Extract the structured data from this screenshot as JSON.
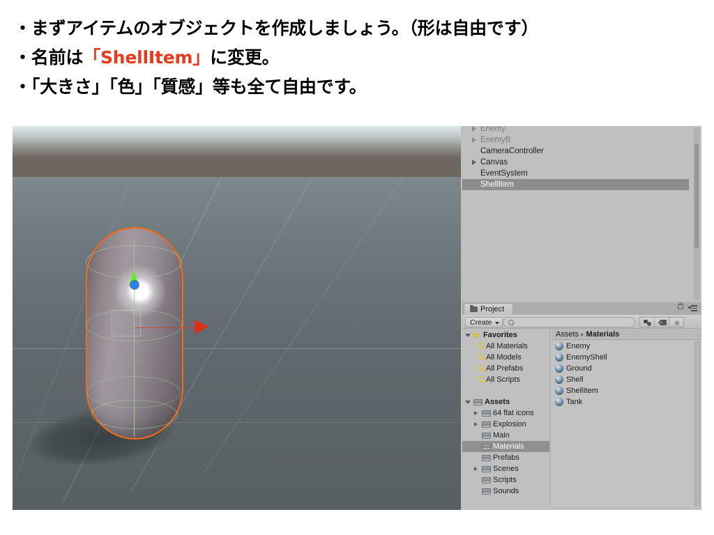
{
  "slide": {
    "bullets": [
      "・まずアイテムのオブジェクトを作成しましょう。（形は自由です）",
      "・名前は",
      "「ShellItem」",
      "に変更。",
      "・「大きさ」「色」「質感」等も全て自由です。"
    ],
    "accent_color": "#e8391a"
  },
  "hierarchy": {
    "items": [
      {
        "label": "Enemy",
        "expandable": true,
        "dim": true,
        "selected": false
      },
      {
        "label": "EnemyB",
        "expandable": true,
        "dim": true,
        "selected": false
      },
      {
        "label": "CameraController",
        "expandable": false,
        "dim": false,
        "selected": false
      },
      {
        "label": "Canvas",
        "expandable": true,
        "dim": false,
        "selected": false
      },
      {
        "label": "EventSystem",
        "expandable": false,
        "dim": false,
        "selected": false
      },
      {
        "label": "ShellItem",
        "expandable": false,
        "dim": false,
        "selected": true
      }
    ]
  },
  "project": {
    "tab_label": "Project",
    "tab_icon": "folder-icon",
    "lock_icon": "lock-icon",
    "menu_icon": "options-menu-icon",
    "create_label": "Create",
    "search_value": "",
    "search_placeholder": "",
    "filter_buttons": [
      {
        "name": "filter-by-type",
        "icon": "shapes-icon"
      },
      {
        "name": "filter-by-label",
        "icon": "tag-icon"
      },
      {
        "name": "filter-favorites",
        "icon": "star-icon",
        "glyph": "★"
      }
    ],
    "breadcrumb": {
      "root": "Assets",
      "separator": "▸",
      "current": "Materials"
    },
    "tree": [
      {
        "label": "Favorites",
        "kind": "favorites",
        "bold": true,
        "expanded": true,
        "depth": 0,
        "selected": false
      },
      {
        "label": "All Materials",
        "kind": "search",
        "bold": false,
        "depth": 1,
        "selected": false
      },
      {
        "label": "All Models",
        "kind": "search",
        "bold": false,
        "depth": 1,
        "selected": false
      },
      {
        "label": "All Prefabs",
        "kind": "search",
        "bold": false,
        "depth": 1,
        "selected": false
      },
      {
        "label": "All Scripts",
        "kind": "search",
        "bold": false,
        "depth": 1,
        "selected": false
      },
      {
        "label": "",
        "kind": "spacer",
        "bold": false,
        "depth": 0,
        "selected": false
      },
      {
        "label": "Assets",
        "kind": "folder",
        "bold": true,
        "expanded": true,
        "depth": 0,
        "selected": false
      },
      {
        "label": "64 flat icons",
        "kind": "folder",
        "bold": false,
        "expandable": true,
        "depth": 1,
        "selected": false
      },
      {
        "label": "Explosion",
        "kind": "folder",
        "bold": false,
        "expandable": true,
        "depth": 1,
        "selected": false
      },
      {
        "label": "Main",
        "kind": "folder",
        "bold": false,
        "expandable": false,
        "depth": 1,
        "selected": false
      },
      {
        "label": "Materials",
        "kind": "folder",
        "bold": false,
        "expandable": false,
        "depth": 1,
        "selected": true
      },
      {
        "label": "Prefabs",
        "kind": "folder",
        "bold": false,
        "expandable": false,
        "depth": 1,
        "selected": false
      },
      {
        "label": "Scenes",
        "kind": "folder",
        "bold": false,
        "expandable": true,
        "depth": 1,
        "selected": false
      },
      {
        "label": "Scripts",
        "kind": "folder",
        "bold": false,
        "expandable": false,
        "depth": 1,
        "selected": false
      },
      {
        "label": "Sounds",
        "kind": "folder",
        "bold": false,
        "expandable": false,
        "depth": 1,
        "selected": false
      }
    ],
    "assets": [
      {
        "label": "Enemy",
        "icon": "material-sphere-icon"
      },
      {
        "label": "EnemyShell",
        "icon": "material-sphere-icon"
      },
      {
        "label": "Ground",
        "icon": "material-sphere-icon"
      },
      {
        "label": "Shell",
        "icon": "material-sphere-icon"
      },
      {
        "label": "ShellItem",
        "icon": "material-sphere-icon"
      },
      {
        "label": "Tank",
        "icon": "material-sphere-icon"
      }
    ]
  },
  "scene": {
    "selected_object": "ShellItem",
    "selection_outline_color": "#f96a10",
    "gizmo": {
      "y_axis_color": "#5ff22a",
      "x_axis_color": "#e02d16",
      "z_axis_color": "#2b7ef0"
    }
  },
  "colors": {
    "panel_bg": "#c0c0c0",
    "selected_row": "#8c8c8c",
    "ground": "#5f686c",
    "sky": "#c2cccd"
  }
}
